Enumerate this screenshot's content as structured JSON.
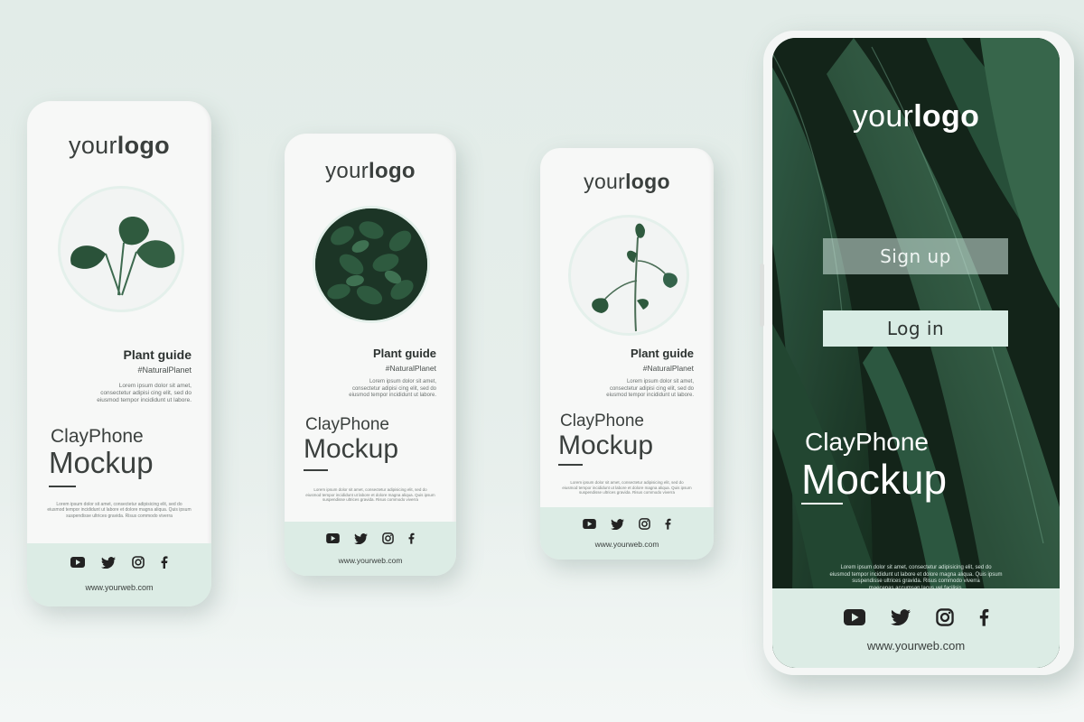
{
  "logo": {
    "light": "your",
    "bold": "logo"
  },
  "plant_guide": {
    "title": "Plant guide",
    "tag": "#NaturalPlanet",
    "lorem": [
      "Lorem ipsum dolor sit amet,",
      "consectetur adipisi cing elit, sed do",
      "eiusmod tempor incididunt ut labore."
    ]
  },
  "brand": {
    "line1": "ClayPhone",
    "line2": "Mockup"
  },
  "small_lorem": [
    "Lorem ipsum dolor sit amet, consectetur adipisicing elit, sed do",
    "eiusmod tempor incididunt ut labore et dolore magna aliqua. Quis ipsum",
    "suspendisse ultrices gravida. Risus commodo viverra",
    "maecenas accumsan lacus vel facilisis."
  ],
  "website": "www.yourweb.com",
  "big_phone": {
    "signup_label": "Sign up",
    "login_label": "Log in"
  },
  "social_icons": [
    "youtube-icon",
    "twitter-icon",
    "instagram-icon",
    "facebook-icon"
  ],
  "colors": {
    "mint": "#dcece5",
    "leaf_dark": "#1f3a2c",
    "text_dark": "#3b403e"
  }
}
